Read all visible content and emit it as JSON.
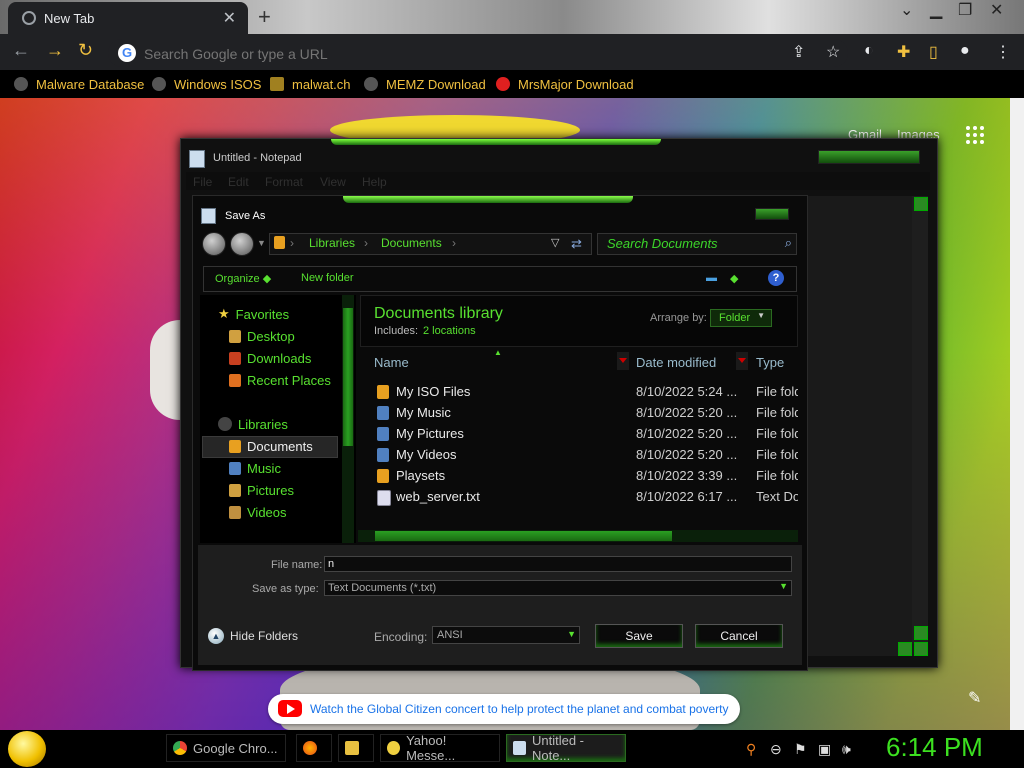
{
  "browser": {
    "tab_title": "New Tab",
    "omnibox_placeholder": "Search Google or type a URL",
    "bookmarks": [
      {
        "label": "Malware Database"
      },
      {
        "label": "Windows ISOS"
      },
      {
        "label": "malwat.ch"
      },
      {
        "label": "MEMZ Download"
      },
      {
        "label": "MrsMajor Download"
      }
    ]
  },
  "newtab": {
    "gmail": "Gmail",
    "images": "Images",
    "promo": "Watch the Global Citizen concert to help protect the planet and combat poverty"
  },
  "notepad": {
    "title": "Untitled - Notepad",
    "menu": [
      "File",
      "Edit",
      "Format",
      "View",
      "Help"
    ]
  },
  "saveas": {
    "title": "Save As",
    "breadcrumb": [
      "Libraries",
      "Documents"
    ],
    "search_placeholder": "Search Documents",
    "organize": "Organize",
    "new_folder": "New folder",
    "help": "?",
    "nav": {
      "favorites": "Favorites",
      "desktop": "Desktop",
      "downloads": "Downloads",
      "recent": "Recent Places",
      "libraries": "Libraries",
      "documents": "Documents",
      "music": "Music",
      "pictures": "Pictures",
      "videos": "Videos"
    },
    "library_title": "Documents library",
    "includes_label": "Includes:",
    "includes_link": "2 locations",
    "arrange_label": "Arrange by:",
    "arrange_value": "Folder",
    "columns": {
      "name": "Name",
      "date": "Date modified",
      "type": "Type"
    },
    "files": [
      {
        "name": "My ISO Files",
        "date": "8/10/2022 5:24 ...",
        "type": "File folder"
      },
      {
        "name": "My Music",
        "date": "8/10/2022 5:20 ...",
        "type": "File folder"
      },
      {
        "name": "My Pictures",
        "date": "8/10/2022 5:20 ...",
        "type": "File folder"
      },
      {
        "name": "My Videos",
        "date": "8/10/2022 5:20 ...",
        "type": "File folder"
      },
      {
        "name": "Playsets",
        "date": "8/10/2022 3:39 ...",
        "type": "File folder"
      },
      {
        "name": "web_server.txt",
        "date": "8/10/2022 6:17 ...",
        "type": "Text Document"
      }
    ],
    "file_name_label": "File name:",
    "file_name_value": "n",
    "save_type_label": "Save as type:",
    "save_type_value": "Text Documents (*.txt)",
    "hide_folders": "Hide Folders",
    "encoding_label": "Encoding:",
    "encoding_value": "ANSI",
    "save": "Save",
    "cancel": "Cancel"
  },
  "taskbar": {
    "items": [
      "Google Chro...",
      "Yahoo! Messe...",
      "Untitled - Note..."
    ],
    "clock": "6:14 PM"
  },
  "colors": {
    "accent_green": "#58e030",
    "clock_green": "#3ce020"
  }
}
